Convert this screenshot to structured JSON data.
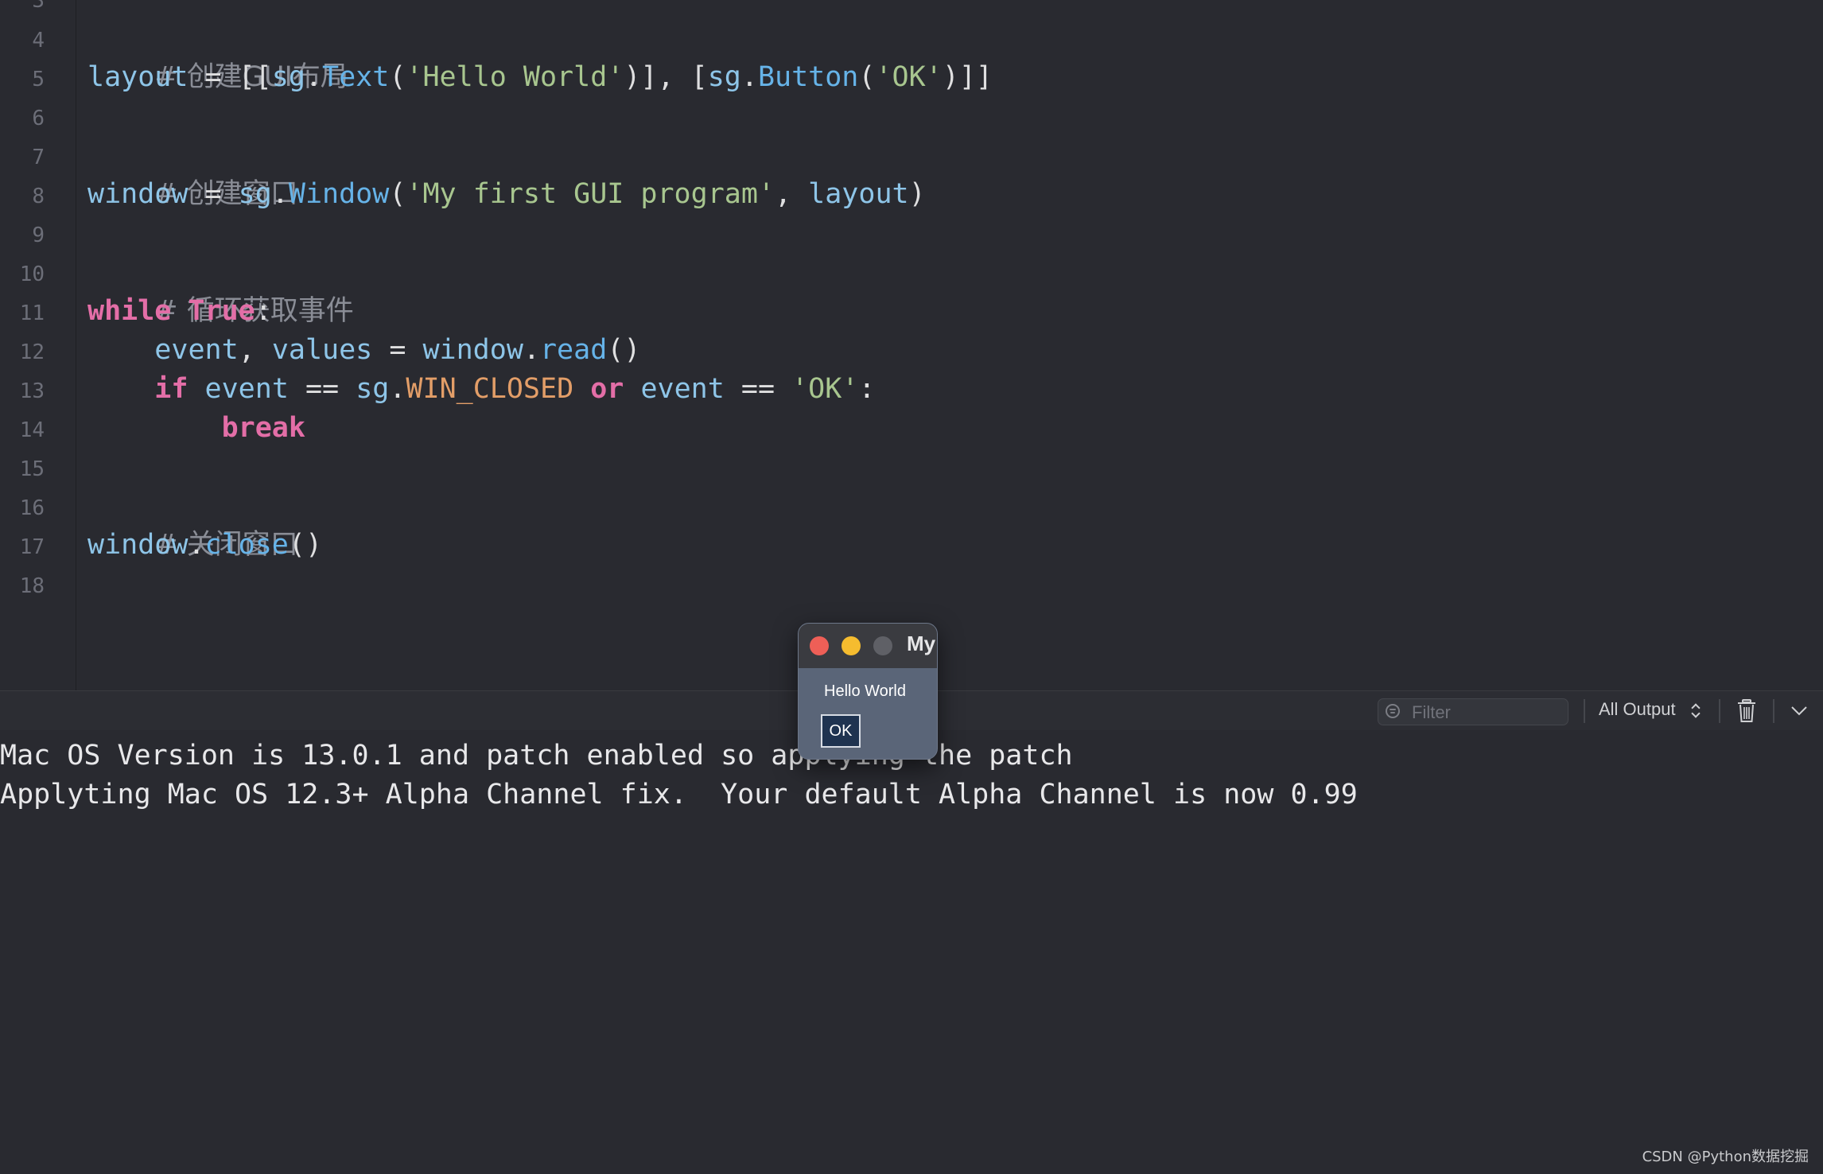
{
  "editor": {
    "line_numbers": [
      "3",
      "4",
      "5",
      "6",
      "7",
      "8",
      "9",
      "10",
      "11",
      "12",
      "13",
      "14",
      "15",
      "16",
      "17",
      "18"
    ],
    "lines": {
      "l4": {
        "comment": "# 创建GUI布局"
      },
      "l5": {
        "t1": "layout",
        "t2": " = [[",
        "t3": "sg",
        "t4": ".",
        "t5": "Text",
        "t6": "(",
        "t7": "'Hello World'",
        "t8": ")], [",
        "t9": "sg",
        "t10": ".",
        "t11": "Button",
        "t12": "(",
        "t13": "'OK'",
        "t14": ")]]"
      },
      "l7": {
        "comment": "# 创建窗口"
      },
      "l8": {
        "t1": "window",
        "t2": " = ",
        "t3": "sg",
        "t4": ".",
        "t5": "Window",
        "t6": "(",
        "t7": "'My first GUI program'",
        "t8": ", ",
        "t9": "layout",
        "t10": ")"
      },
      "l10": {
        "comment": "# 循环获取事件"
      },
      "l11": {
        "t1": "while",
        "t2": " ",
        "t3": "True",
        "t4": ":"
      },
      "l12": {
        "t1": "    ",
        "t2": "event",
        "t3": ", ",
        "t4": "values",
        "t5": " = ",
        "t6": "window",
        "t7": ".",
        "t8": "read",
        "t9": "()"
      },
      "l13": {
        "t1": "    ",
        "t2": "if",
        "t3": " ",
        "t4": "event",
        "t5": " == ",
        "t6": "sg",
        "t7": ".",
        "t8": "WIN_CLOSED",
        "t9": " ",
        "t10": "or",
        "t11": " ",
        "t12": "event",
        "t13": " == ",
        "t14": "'OK'",
        "t15": ":"
      },
      "l14": {
        "t1": "        ",
        "t2": "break"
      },
      "l16": {
        "comment": "# 关闭窗口"
      },
      "l17": {
        "t1": "window",
        "t2": ".",
        "t3": "close",
        "t4": "()"
      }
    }
  },
  "console": {
    "filter_placeholder": "Filter",
    "output_select": "All Output",
    "lines": [
      "Mac OS Version is 13.0.1 and patch enabled so applying the patch",
      "Applyting Mac OS 12.3+ Alpha Channel fix.  Your default Alpha Channel is now 0.99"
    ]
  },
  "popup": {
    "title": "My first GUI program",
    "text": "Hello World",
    "button_label": "OK"
  },
  "watermark": "CSDN @Python数据挖掘",
  "colors": {
    "editor_bg": "#292a30",
    "keyword": "#e36ea7",
    "string": "#a8c68f",
    "function": "#66b3e8",
    "constant": "#e39e68",
    "comment": "#8a8d96"
  }
}
